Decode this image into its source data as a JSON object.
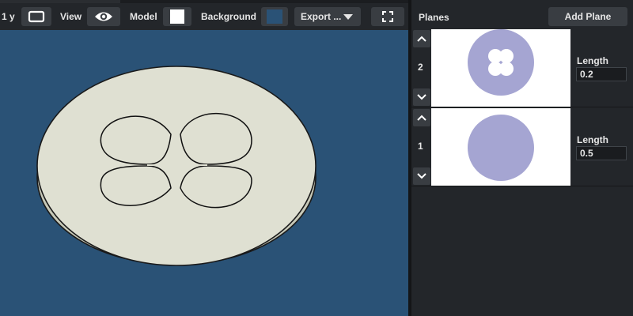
{
  "toolbar": {
    "fragment_label": "1 y",
    "view_label": "View",
    "model_label": "Model",
    "background_label": "Background",
    "export_label": "Export ...",
    "model_color": "#ffffff",
    "background_color": "#2a5276",
    "icons": [
      "frame-icon",
      "eye-icon",
      "caret-down-icon",
      "fullscreen-icon"
    ]
  },
  "panel": {
    "title": "Planes",
    "add_plane_label": "Add Plane",
    "planes": [
      {
        "number": "2",
        "length_label": "Length",
        "length_value": "0.2",
        "shape": "circle-with-clover-hole"
      },
      {
        "number": "1",
        "length_label": "Length",
        "length_value": "0.5",
        "shape": "solid-circle"
      }
    ],
    "thumbnail_color": "#a5a5d2"
  },
  "model": {
    "face_color": "#dfe0d2",
    "side_color": "#c7c9b8"
  }
}
